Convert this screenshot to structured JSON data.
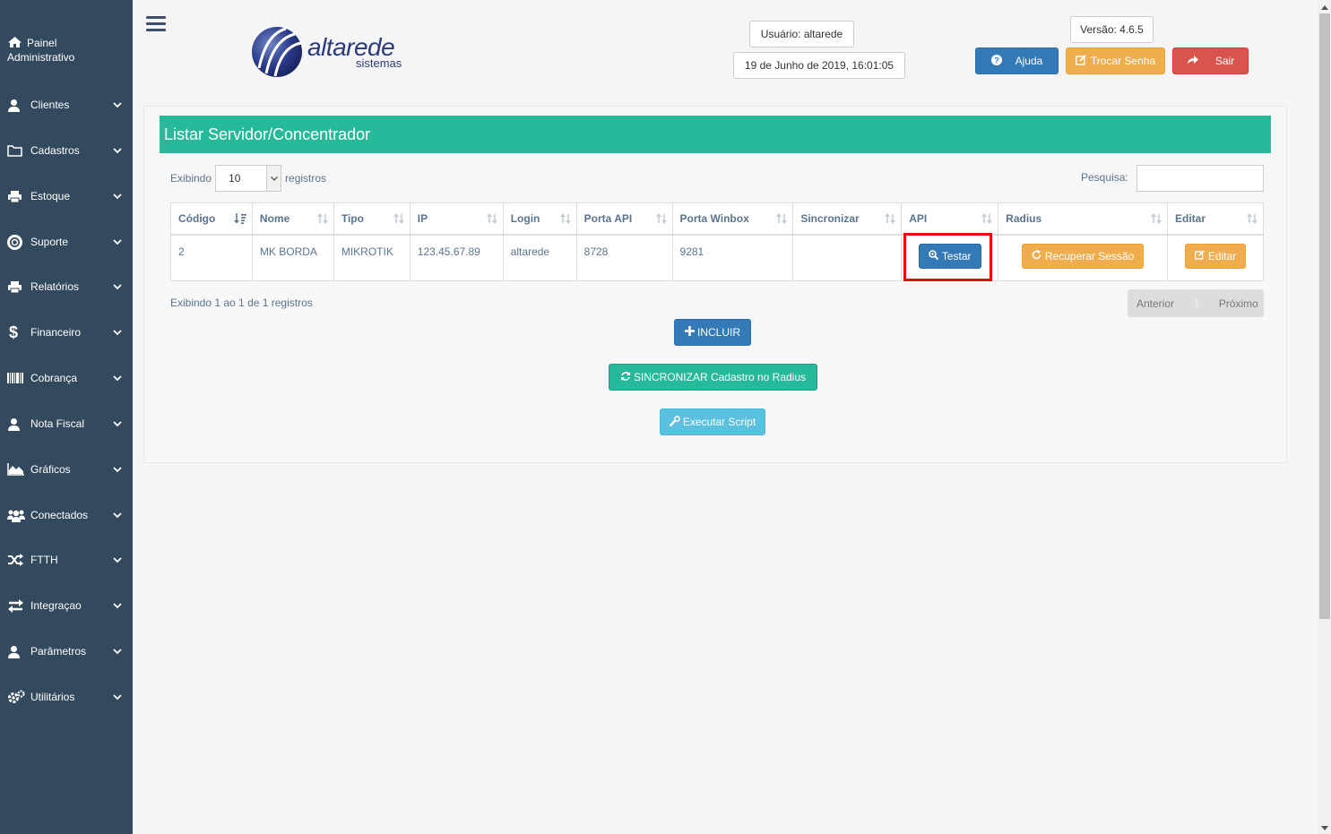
{
  "sidebar": {
    "brand_line1": "Painel",
    "brand_line2": "Administrativo",
    "items": [
      {
        "label": "Clientes",
        "icon": "user-icon"
      },
      {
        "label": "Cadastros",
        "icon": "folder-icon"
      },
      {
        "label": "Estoque",
        "icon": "print-icon"
      },
      {
        "label": "Suporte",
        "icon": "lifebuoy-icon"
      },
      {
        "label": "Relatórios",
        "icon": "print-icon"
      },
      {
        "label": "Financeiro",
        "icon": "dollar-icon"
      },
      {
        "label": "Cobrança",
        "icon": "barcode-icon"
      },
      {
        "label": "Nota Fiscal",
        "icon": "user-icon"
      },
      {
        "label": "Gráficos",
        "icon": "area-chart-icon"
      },
      {
        "label": "Conectados",
        "icon": "users-icon"
      },
      {
        "label": "FTTH",
        "icon": "shuffle-icon"
      },
      {
        "label": "Integraçao",
        "icon": "exchange-icon"
      },
      {
        "label": "Parâmetros",
        "icon": "user-icon"
      },
      {
        "label": "Utilitários",
        "icon": "cogs-icon"
      }
    ]
  },
  "header": {
    "logo_text": "altarede",
    "logo_sub": "sistemas",
    "user": "Usuário: altarede",
    "datetime": "19 de Junho de 2019, 16:01:05",
    "version": "Versão: 4.6.5",
    "help_label": "Ajuda",
    "change_password_label": "Trocar Senha",
    "logout_label": "Sair"
  },
  "panel": {
    "title": "Listar Servidor/Concentrador",
    "show_prefix": "Exibindo",
    "page_size": "10",
    "show_suffix": "registros",
    "search_label": "Pesquisa:",
    "search_value": "",
    "columns": [
      "Código",
      "Nome",
      "Tipo",
      "IP",
      "Login",
      "Porta API",
      "Porta Winbox",
      "Sincronizar",
      "API",
      "Radius",
      "Editar"
    ],
    "rows": [
      {
        "codigo": "2",
        "nome": "MK BORDA",
        "tipo": "MIKROTIK",
        "ip": "123.45.67.89",
        "login": "altarede",
        "porta_api": "8728",
        "porta_winbox": "9281",
        "sincronizar": "",
        "api_btn": "Testar",
        "radius_btn": "Recuperar Sessão",
        "edit_btn": "Editar"
      }
    ],
    "info": "Exibindo 1 ao 1 de 1 registros",
    "pager": {
      "prev": "Anterior",
      "page": "1",
      "next": "Próximo"
    },
    "add_label": "INCLUIR",
    "sync_label": "SINCRONIZAR Cadastro no Radius",
    "script_label": "Executar Script"
  },
  "colors": {
    "sidebar": "#334a5e",
    "accent_green": "#26b99a",
    "primary": "#337ab7",
    "warning": "#f0ad4e",
    "danger": "#d9534f",
    "info": "#5bc0de",
    "highlight": "#e01010"
  }
}
